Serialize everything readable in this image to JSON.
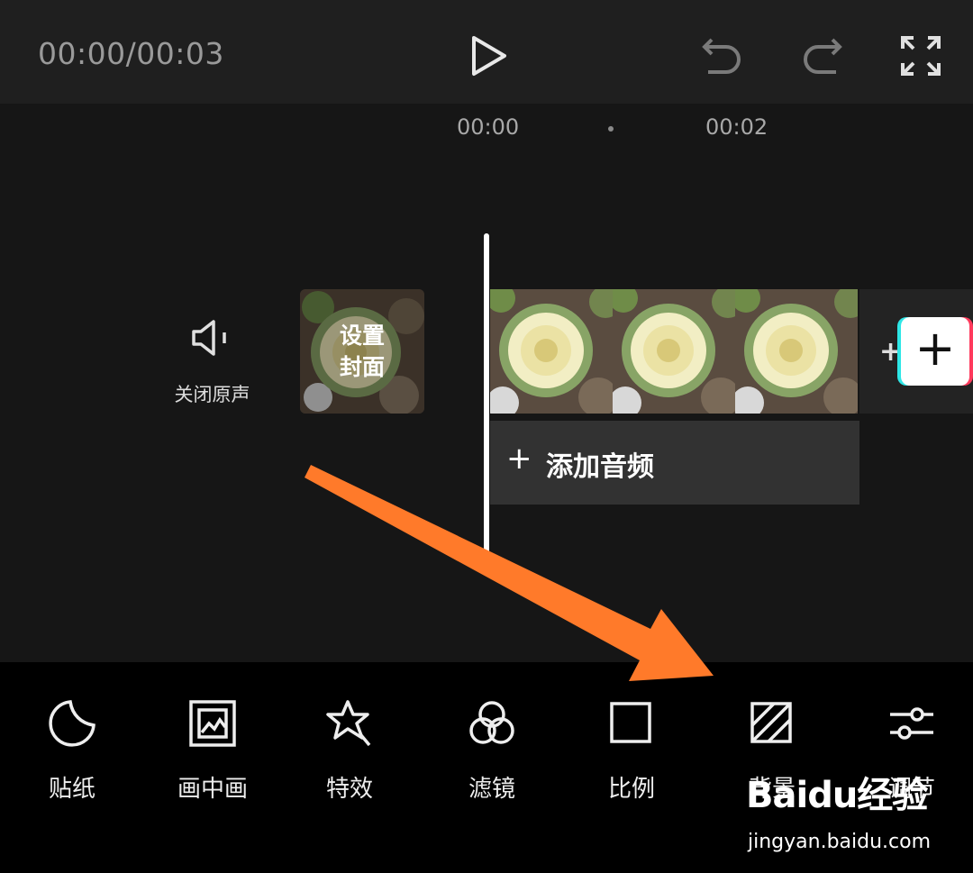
{
  "header": {
    "time_display": "00:00/00:03",
    "play_icon": "play-icon",
    "undo_icon": "undo-icon",
    "redo_icon": "redo-icon",
    "fullscreen_icon": "fullscreen-icon"
  },
  "timeline": {
    "ticks": [
      "00:00",
      "00:02"
    ],
    "mute_label": "关闭原声",
    "cover_label_line1": "设置",
    "cover_label_line2": "封面",
    "add_audio_label": "添加音频",
    "add_clip_symbol": "+",
    "add_audio_symbol": "+"
  },
  "toolbar": {
    "items": [
      {
        "label": "贴纸",
        "icon": "sticker-icon"
      },
      {
        "label": "画中画",
        "icon": "picture-in-picture-icon"
      },
      {
        "label": "特效",
        "icon": "effects-star-icon"
      },
      {
        "label": "滤镜",
        "icon": "filter-icon"
      },
      {
        "label": "比例",
        "icon": "ratio-icon"
      },
      {
        "label": "背景",
        "icon": "background-icon"
      },
      {
        "label": "调节",
        "icon": "adjust-sliders-icon"
      }
    ]
  },
  "watermark": {
    "logo": "Baidu经验",
    "url": "jingyan.baidu.com"
  },
  "colors": {
    "arrow": "#ff7a2a",
    "background": "#151515",
    "toolbar": "#000000"
  }
}
